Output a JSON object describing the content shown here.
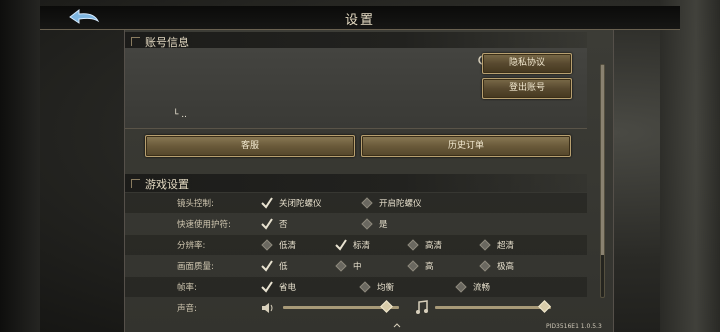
{
  "page": {
    "title": "设置"
  },
  "account": {
    "header": "账号信息",
    "username": "└ ..",
    "privacy_label": "隐私协议",
    "logout_label": "登出账号",
    "support_label": "客服",
    "history_label": "历史订单"
  },
  "game": {
    "header": "游戏设置",
    "rows": [
      {
        "label": "镜头控制:",
        "options": [
          "关闭陀螺仪",
          "开启陀螺仪"
        ],
        "selected": 0
      },
      {
        "label": "快速使用护符:",
        "options": [
          "否",
          "是"
        ],
        "selected": 0
      },
      {
        "label": "分辨率:",
        "options": [
          "低清",
          "标清",
          "高清",
          "超清"
        ],
        "selected": 1
      },
      {
        "label": "画面质量:",
        "options": [
          "低",
          "中",
          "高",
          "极高"
        ],
        "selected": 0
      },
      {
        "label": "帧率:",
        "options": [
          "省电",
          "均衡",
          "流畅"
        ],
        "selected": 0
      },
      {
        "label": "声音:"
      }
    ],
    "sound_volume": 0.9,
    "music_volume": 0.95
  },
  "footer": {
    "version": "PID3516E1 1.0.5.3"
  },
  "colors": {
    "accent": "#b8a070",
    "check": "#e8e2d0"
  }
}
